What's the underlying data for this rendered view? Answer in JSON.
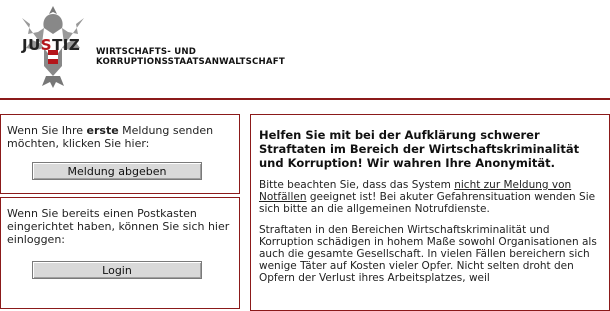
{
  "header": {
    "logo_prefix": "JU",
    "logo_mark": "S",
    "logo_suffix": "TIZ",
    "org_line1": "WIRTSCHAFTS- UND",
    "org_line2": "KORRUPTIONSSTAATSANWALTSCHAFT"
  },
  "box_report": {
    "text_before": "Wenn Sie Ihre ",
    "text_bold": "erste",
    "text_after": " Meldung senden möchten, klicken Sie hier:",
    "button_label": "Meldung abgeben"
  },
  "box_login": {
    "text": "Wenn Sie bereits einen Postkasten eingerichtet haben, können Sie sich hier einloggen:",
    "button_label": "Login"
  },
  "main": {
    "heading": "Helfen Sie mit bei der Aufklärung schwerer Straftaten im Bereich der Wirtschaftskriminalität und Korruption! Wir wahren Ihre Anonymität.",
    "p1_before": "Bitte beachten Sie, dass das System ",
    "p1_link": "nicht zur Meldung von Notfällen",
    "p1_after": " geeignet ist! Bei akuter Gefahrensituation wenden Sie sich bitte an die allgemeinen Notrufdienste.",
    "p2": "Straftaten in den Bereichen Wirtschaftskriminalität und Korruption schädigen in hohem Maße sowohl Organisationen als auch die gesamte Gesellschaft. In vielen Fällen bereichern sich wenige Täter auf Kosten vieler Opfer. Nicht selten droht den Opfern der Verlust ihres Arbeitsplatzes, weil"
  },
  "colors": {
    "accent": "#8b1a1a",
    "logo_red": "#b4161b"
  }
}
